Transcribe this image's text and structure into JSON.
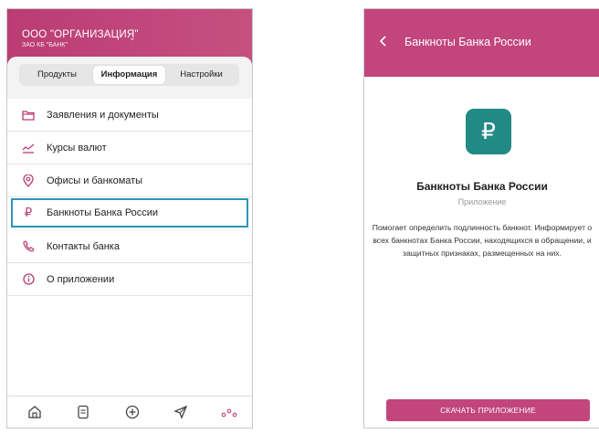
{
  "left": {
    "org_name": "ООО \"ОРГАНИЗАЦИЯ\"",
    "bank_name": "ЗАО КБ \"БАНК\"",
    "tabs": [
      {
        "label": "Продукты",
        "active": false
      },
      {
        "label": "Информация",
        "active": true
      },
      {
        "label": "Настройки",
        "active": false
      }
    ],
    "menu": [
      {
        "label": "Заявления и документы",
        "icon": "folder-icon"
      },
      {
        "label": "Курсы валют",
        "icon": "exchange-rate-icon"
      },
      {
        "label": "Офисы и банкоматы",
        "icon": "location-pin-icon"
      },
      {
        "label": "Банкноты Банка России",
        "icon": "ruble-icon",
        "selected": true
      },
      {
        "label": "Контакты банка",
        "icon": "phone-icon"
      },
      {
        "label": "О приложении",
        "icon": "info-icon"
      }
    ],
    "bottom_nav": [
      "home-icon",
      "document-icon",
      "add-icon",
      "send-icon",
      "more-icon"
    ]
  },
  "right": {
    "title": "Банкноты Банка России",
    "app_icon_symbol": "₽",
    "app_name": "Банкноты Банка России",
    "app_type": "Приложение",
    "description": "Помогает определить подлинность банкнот. Информирует о всех банкнотах Банка России, находящихся в обращении, и защитных признаках, размещенных на них.",
    "download_label": "СКАЧАТЬ ПРИЛОЖЕНИЕ"
  },
  "colors": {
    "brand": "#c2457c",
    "app_icon_bg": "#228a85",
    "selection_border": "#2b96b8"
  }
}
